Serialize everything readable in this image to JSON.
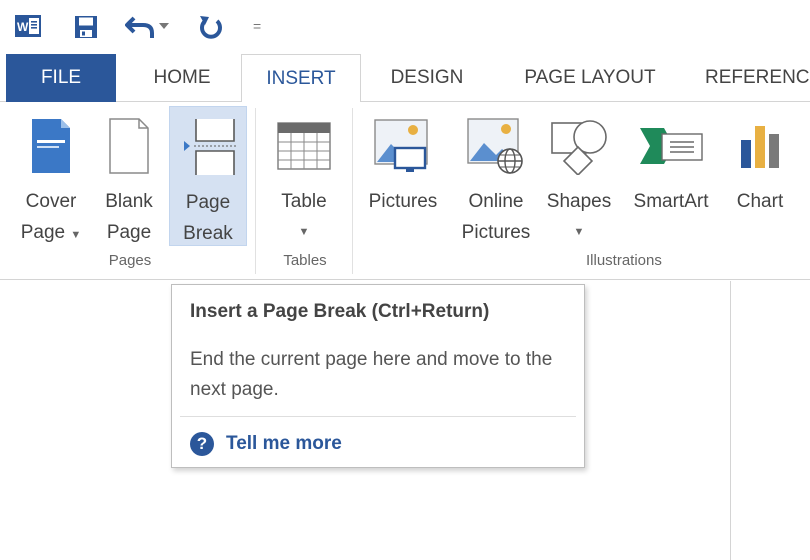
{
  "quick_access": {
    "icons": [
      "word-app-icon",
      "save-icon",
      "undo-icon",
      "redo-icon",
      "customize-toolbar-icon"
    ],
    "separator": "="
  },
  "tabs": [
    "FILE",
    "HOME",
    "INSERT",
    "DESIGN",
    "PAGE LAYOUT",
    "REFERENC"
  ],
  "active_tab": "INSERT",
  "ribbon": {
    "pages": {
      "cover_page": [
        "Cover",
        "Page"
      ],
      "blank_page": [
        "Blank",
        "Page"
      ],
      "page_break": [
        "Page",
        "Break"
      ],
      "group_label": "Pages"
    },
    "tables": {
      "table": "Table",
      "group_label": "Tables"
    },
    "illustrations": {
      "pictures": "Pictures",
      "online_pictures": [
        "Online",
        "Pictures"
      ],
      "shapes": "Shapes",
      "smartart": "SmartArt",
      "chart": "Chart",
      "group_label": "Illustrations"
    }
  },
  "tooltip": {
    "title": "Insert a Page Break (Ctrl+Return)",
    "body": "End the current page here and move to the next page.",
    "help_glyph": "?",
    "help_link": "Tell me more"
  },
  "colors": {
    "accent": "#2b579a",
    "hover": "#d5e1f2",
    "file_tab": "#2b579a"
  }
}
